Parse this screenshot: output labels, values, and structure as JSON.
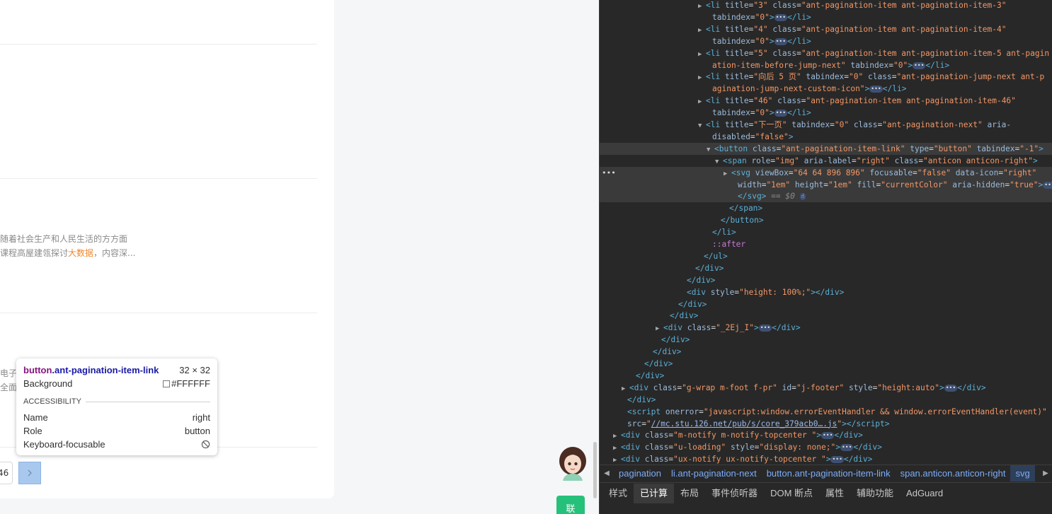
{
  "page": {
    "snippet_line1": "随着社会生产和人民生活的方方面",
    "snippet_line2_pre": "课程高屋建瓴探讨",
    "snippet_line2_hl": "大数据",
    "snippet_line2_post": "，内容深...",
    "snippet_line3": "电子",
    "snippet_line4": "全面",
    "pager_input_value": "46",
    "contact_label": "联"
  },
  "tooltip": {
    "element_tag": "button",
    "element_class": ".ant-pagination-item-link",
    "dims": "32 × 32",
    "background_label": "Background",
    "background_value": "#FFFFFF",
    "section_title": "ACCESSIBILITY",
    "name_label": "Name",
    "name_value": "right",
    "role_label": "Role",
    "role_value": "button",
    "focusable_label": "Keyboard-focusable"
  },
  "devtools": {
    "lines": [
      {
        "indent": 150,
        "tri": "▶",
        "html": "<span class='tag'>&lt;li</span> <span class='an'>title</span>=<span class='av'>\"3\"</span> <span class='an'>class</span>=<span class='av'>\"ant-pagination-item ant-pagination-item-3\"</span>"
      },
      {
        "indent": 159,
        "html": "<span class='an'>tabindex</span>=<span class='av'>\"0\"</span><span class='tag'>&gt;</span><span class='ell'>•••</span><span class='tag'>&lt;/li&gt;</span>"
      },
      {
        "indent": 150,
        "tri": "▶",
        "html": "<span class='tag'>&lt;li</span> <span class='an'>title</span>=<span class='av'>\"4\"</span> <span class='an'>class</span>=<span class='av'>\"ant-pagination-item ant-pagination-item-4\"</span>"
      },
      {
        "indent": 159,
        "html": "<span class='an'>tabindex</span>=<span class='av'>\"0\"</span><span class='tag'>&gt;</span><span class='ell'>•••</span><span class='tag'>&lt;/li&gt;</span>"
      },
      {
        "indent": 150,
        "tri": "▶",
        "html": "<span class='tag'>&lt;li</span> <span class='an'>title</span>=<span class='av'>\"5\"</span> <span class='an'>class</span>=<span class='av'>\"ant-pagination-item ant-pagination-item-5 ant-pagin</span>"
      },
      {
        "indent": 159,
        "html": "<span class='av'>ation-item-before-jump-next\"</span> <span class='an'>tabindex</span>=<span class='av'>\"0\"</span><span class='tag'>&gt;</span><span class='ell'>•••</span><span class='tag'>&lt;/li&gt;</span>"
      },
      {
        "indent": 150,
        "tri": "▶",
        "html": "<span class='tag'>&lt;li</span> <span class='an'>title</span>=<span class='av'>\"向后 5 页\"</span> <span class='an'>tabindex</span>=<span class='av'>\"0\"</span> <span class='an'>class</span>=<span class='av'>\"ant-pagination-jump-next ant-p</span>"
      },
      {
        "indent": 159,
        "html": "<span class='av'>agination-jump-next-custom-icon\"</span><span class='tag'>&gt;</span><span class='ell'>•••</span><span class='tag'>&lt;/li&gt;</span>"
      },
      {
        "indent": 150,
        "tri": "▶",
        "html": "<span class='tag'>&lt;li</span> <span class='an'>title</span>=<span class='av'>\"46\"</span> <span class='an'>class</span>=<span class='av'>\"ant-pagination-item ant-pagination-item-46\"</span>"
      },
      {
        "indent": 159,
        "html": "<span class='an'>tabindex</span>=<span class='av'>\"0\"</span><span class='tag'>&gt;</span><span class='ell'>•••</span><span class='tag'>&lt;/li&gt;</span>"
      },
      {
        "indent": 150,
        "tri": "▼",
        "html": "<span class='tag'>&lt;li</span> <span class='an'>title</span>=<span class='av'>\"下一页\"</span> <span class='an'>tabindex</span>=<span class='av'>\"0\"</span> <span class='an'>class</span>=<span class='av'>\"ant-pagination-next\"</span> <span class='an'>aria-</span>"
      },
      {
        "indent": 159,
        "html": "<span class='an'>disabled</span>=<span class='av'>\"false\"</span><span class='tag'>&gt;</span>"
      },
      {
        "indent": 162,
        "tri": "▼",
        "cls": "sel",
        "html": "<span class='tag'>&lt;button</span> <span class='an'>class</span>=<span class='av'>\"ant-pagination-item-link\"</span> <span class='an'>type</span>=<span class='av'>\"button\"</span> <span class='an'>tabindex</span>=<span class='av'>\"-1\"</span><span class='tag'>&gt;</span>"
      },
      {
        "indent": 174,
        "tri": "▼",
        "html": "<span class='tag'>&lt;span</span> <span class='an'>role</span>=<span class='av'>\"img\"</span> <span class='an'>aria-label</span>=<span class='av'>\"right\"</span> <span class='an'>class</span>=<span class='av'>\"anticon anticon-right\"</span><span class='tag'>&gt;</span>"
      },
      {
        "indent": 186,
        "tri": "▶",
        "cls": "hov",
        "dots": true,
        "html": "<span class='tag'>&lt;svg</span> <span class='an'>viewBox</span>=<span class='av'>\"64 64 896 896\"</span> <span class='an'>focusable</span>=<span class='av'>\"false\"</span> <span class='an'>data-icon</span>=<span class='av'>\"right\"</span>"
      },
      {
        "indent": 195,
        "cls": "hov",
        "html": "<span class='an'>width</span>=<span class='av'>\"1em\"</span> <span class='an'>height</span>=<span class='av'>\"1em\"</span> <span class='an'>fill</span>=<span class='av'>\"currentColor\"</span> <span class='an'>aria-hidden</span>=<span class='av'>\"true\"</span><span class='tag'>&gt;</span><span class='ell'>•••</span>"
      },
      {
        "indent": 195,
        "cls": "hov",
        "html": "<span class='tag'>&lt;/svg&gt;</span> <span class='dim'>== $0</span> <span class='ell'>☝</span>"
      },
      {
        "indent": 183,
        "html": "<span class='tag'>&lt;/span&gt;</span>"
      },
      {
        "indent": 171,
        "html": "<span class='tag'>&lt;/button&gt;</span>"
      },
      {
        "indent": 159,
        "html": "<span class='tag'>&lt;/li&gt;</span>"
      },
      {
        "indent": 159,
        "html": "<span class='pse'>::after</span>"
      },
      {
        "indent": 147,
        "html": "<span class='tag'>&lt;/ul&gt;</span>"
      },
      {
        "indent": 135,
        "html": "<span class='tag'>&lt;/div&gt;</span>"
      },
      {
        "indent": 123,
        "html": "<span class='tag'>&lt;/div&gt;</span>"
      },
      {
        "indent": 123,
        "html": "<span class='tag'>&lt;div</span> <span class='an'>style</span>=<span class='av'>\"height: 100%;\"</span><span class='tag'>&gt;&lt;/div&gt;</span>"
      },
      {
        "indent": 111,
        "html": "<span class='tag'>&lt;/div&gt;</span>"
      },
      {
        "indent": 99,
        "html": "<span class='tag'>&lt;/div&gt;</span>"
      },
      {
        "indent": 90,
        "tri": "▶",
        "html": "<span class='tag'>&lt;div</span> <span class='an'>class</span>=<span class='av'>\"_2Ej_I\"</span><span class='tag'>&gt;</span><span class='ell'>•••</span><span class='tag'>&lt;/div&gt;</span>"
      },
      {
        "indent": 87,
        "html": "<span class='tag'>&lt;/div&gt;</span>"
      },
      {
        "indent": 75,
        "html": "<span class='tag'>&lt;/div&gt;</span>"
      },
      {
        "indent": 63,
        "html": "<span class='tag'>&lt;/div&gt;</span>"
      },
      {
        "indent": 51,
        "html": "<span class='tag'>&lt;/div&gt;</span>"
      },
      {
        "indent": 42,
        "tri": "▶",
        "html": "<span class='tag'>&lt;div</span> <span class='an'>class</span>=<span class='av'>\"g-wrap m-foot f-pr\"</span> <span class='an'>id</span>=<span class='av'>\"j-footer\"</span> <span class='an'>style</span>=<span class='av'>\"height:auto\"</span><span class='tag'>&gt;</span><span class='ell'>•••</span><span class='tag'>&lt;/div&gt;</span>"
      },
      {
        "indent": 39,
        "html": "<span class='tag'>&lt;/div&gt;</span>"
      },
      {
        "indent": 39,
        "html": "<span class='tag'>&lt;script</span> <span class='an'>onerror</span>=<span class='av'>\"javascript:window.errorEventHandler &amp;&amp; window.errorEventHandler(event)\"</span>"
      },
      {
        "indent": 39,
        "html": "<span class='an'>src</span>=<span class='av'>\"</span><span class='lnk'>//mc.stu.126.net/pub/s/core_379acb0….js</span><span class='av'>\"</span><span class='tag'>&gt;&lt;/script&gt;</span>"
      },
      {
        "indent": 30,
        "tri": "▶",
        "html": "<span class='tag'>&lt;div</span> <span class='an'>class</span>=<span class='av'>\"m-notify m-notify-topcenter \"</span><span class='tag'>&gt;</span><span class='ell'>•••</span><span class='tag'>&lt;/div&gt;</span>"
      },
      {
        "indent": 30,
        "tri": "▶",
        "html": "<span class='tag'>&lt;div</span> <span class='an'>class</span>=<span class='av'>\"u-loading\"</span> <span class='an'>style</span>=<span class='av'>\"display: none;\"</span><span class='tag'>&gt;</span><span class='ell'>•••</span><span class='tag'>&lt;/div&gt;</span>"
      },
      {
        "indent": 30,
        "tri": "▶",
        "html": "<span class='tag'>&lt;div</span> <span class='an'>class</span>=<span class='av'>\"ux-notify ux-notify-topcenter \"</span><span class='tag'>&gt;</span><span class='ell'>•••</span><span class='tag'>&lt;/div&gt;</span>"
      }
    ],
    "breadcrumbs": [
      "pagination",
      "li.ant-pagination-next",
      "button.ant-pagination-item-link",
      "span.anticon.anticon-right",
      "svg"
    ],
    "tabs": [
      "样式",
      "已计算",
      "布局",
      "事件侦听器",
      "DOM 断点",
      "属性",
      "辅助功能",
      "AdGuard"
    ],
    "active_tab_index": 1
  },
  "icons": {
    "next_button_icon": "chevron-right-icon",
    "not_focusable_icon": "blocked-circle-icon",
    "breadcrumb_left_icon": "caret-left-icon",
    "breadcrumb_right_icon": "caret-right-icon"
  },
  "colors": {
    "devtools_bg": "#282828",
    "tag": "#5db0d7",
    "attr_name": "#9bbbdc",
    "attr_value": "#f29766",
    "tooltip_tag": "#881280",
    "contact_green": "#25c17a"
  }
}
